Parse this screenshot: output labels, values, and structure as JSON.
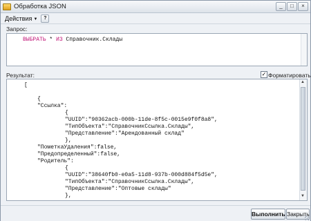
{
  "window": {
    "title": "Обработка JSON",
    "controls": [
      "_",
      "□",
      "×"
    ]
  },
  "toolbar": {
    "actions_label": "Действия",
    "help_label": "?"
  },
  "query": {
    "label": "Запрос:",
    "keyword_select": "ВЫБРАТЬ",
    "rest": " * ",
    "keyword_from": "ИЗ",
    "source": " Справочник.Склады"
  },
  "result": {
    "label": "Результат:",
    "format_label": "Форматировать",
    "format_checked": true,
    "lines": [
      "[",
      "",
      "{",
      "\"Ссылка\":",
      "{",
      "\"UUID\":\"90362acb-000b-11de-8f5c-0015e9f0f8a8\",",
      "\"ТипОбъекта\":\"СправочникСсылка.Склады\",",
      "\"Представление\":\"Арендованный склад\"",
      "},",
      "\"ПометкаУдаления\":false,",
      "\"Предопределенный\":false,",
      "\"Родитель\":",
      "{",
      "\"UUID\":\"38640fb0-e0a5-11d8-937b-000d884f5d5e\",",
      "\"ТипОбъекта\":\"СправочникСсылка.Склады\",",
      "\"Представление\":\"Оптовые склады\"",
      "},"
    ]
  },
  "buttons": {
    "execute": "Выполнить",
    "close": "Закрыть"
  }
}
